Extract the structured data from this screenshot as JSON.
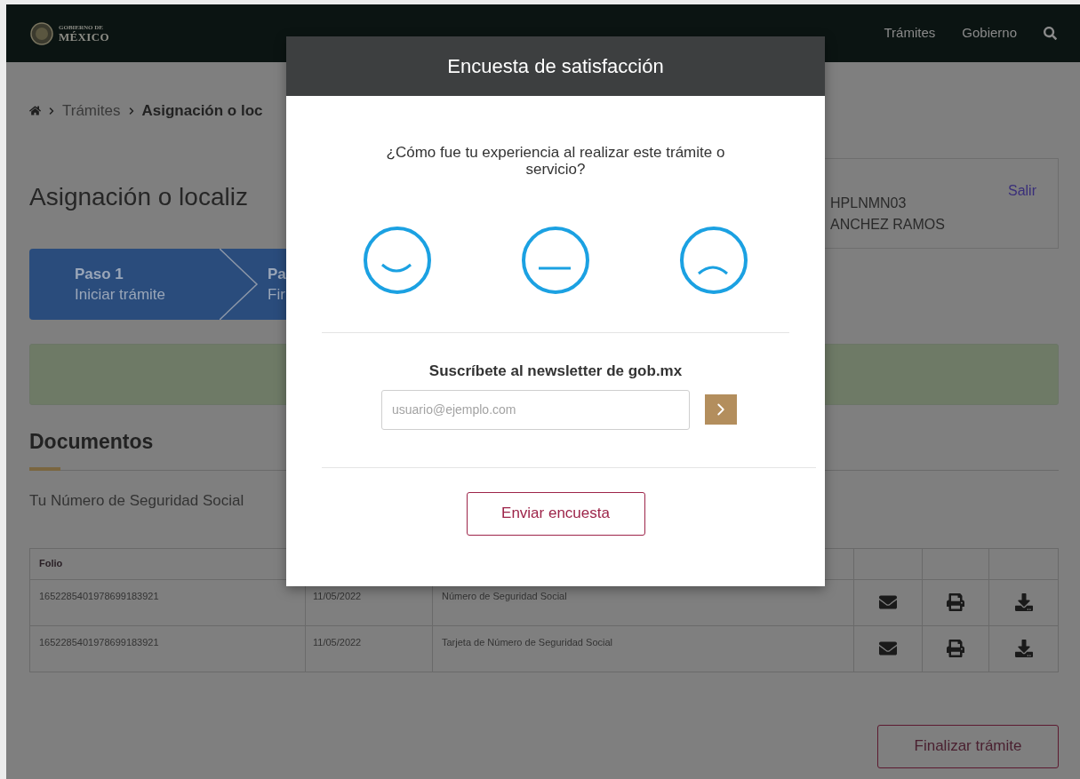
{
  "header": {
    "logo_small": "GOBIERNO DE",
    "logo_large": "MÉXICO",
    "nav": [
      "Trámites",
      "Gobierno"
    ]
  },
  "breadcrumb": [
    "Trámites",
    "Asignación o loc"
  ],
  "title": "Asignación o localiz",
  "user_box": {
    "lines": [
      "HPLNMN03",
      "ANCHEZ RAMOS"
    ],
    "logout": "Salir"
  },
  "steps": [
    {
      "label": "Paso 1",
      "sublabel": "Iniciar trámite"
    },
    {
      "label": "Pa",
      "sublabel": "Fir"
    }
  ],
  "documents": {
    "title": "Documentos",
    "description": "Tu Número de Seguridad Social",
    "columns": [
      "Folio"
    ],
    "rows": [
      {
        "folio": "1652285401978699183921",
        "date": "11/05/2022",
        "document": "Número de Seguridad Social"
      },
      {
        "folio": "1652285401978699183921",
        "date": "11/05/2022",
        "document": "Tarjeta de Número de Seguridad Social"
      }
    ]
  },
  "finish_button": "Finalizar trámite",
  "survey": {
    "title": "Encuesta de satisfacción",
    "question": "¿Cómo fue tu experiencia al realizar este trámite o servicio?",
    "ratings": [
      {
        "kind": "happy"
      },
      {
        "kind": "neutral"
      },
      {
        "kind": "sad"
      }
    ],
    "newsletter": {
      "title": "Suscríbete al newsletter de gob.mx",
      "placeholder": "usuario@ejemplo.com"
    },
    "submit": "Enviar encuesta"
  }
}
